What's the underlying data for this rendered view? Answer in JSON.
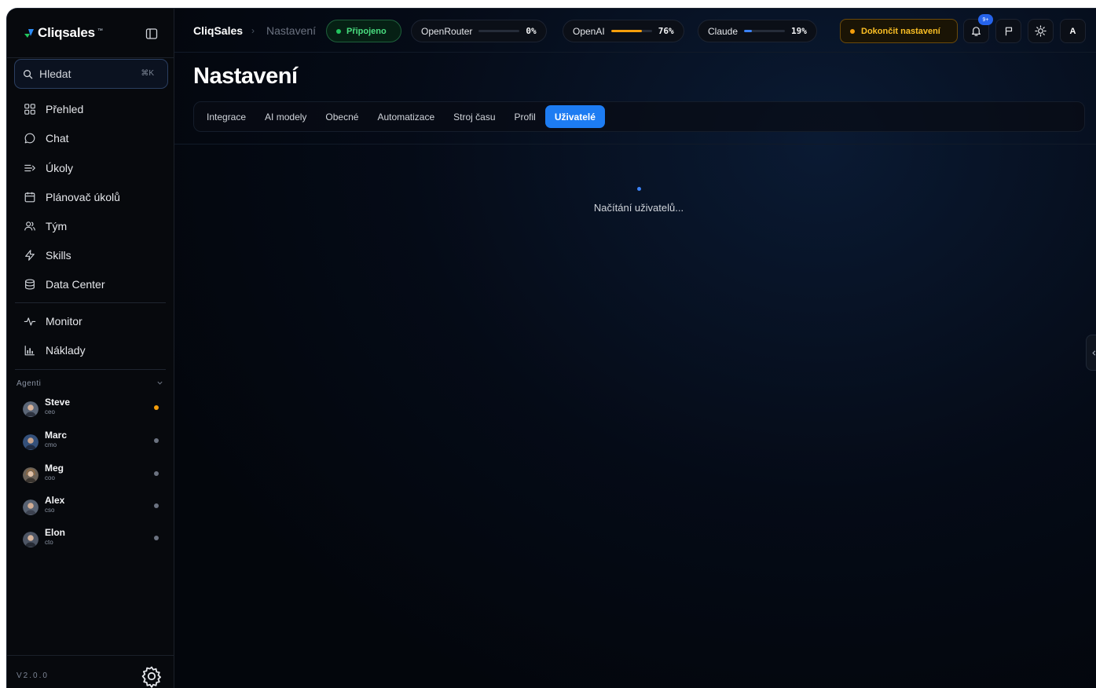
{
  "brand": {
    "name": "Cliqsales",
    "tm": "™"
  },
  "search": {
    "placeholder": "Hledat",
    "shortcut": "⌘K"
  },
  "nav": {
    "primary": [
      {
        "label": "Přehled",
        "icon": "grid-icon"
      },
      {
        "label": "Chat",
        "icon": "chat-icon"
      },
      {
        "label": "Úkoly",
        "icon": "tasks-icon"
      },
      {
        "label": "Plánovač úkolů",
        "icon": "calendar-icon"
      },
      {
        "label": "Tým",
        "icon": "team-icon"
      },
      {
        "label": "Skills",
        "icon": "lightning-icon"
      },
      {
        "label": "Data Center",
        "icon": "database-icon"
      }
    ],
    "secondary": [
      {
        "label": "Monitor",
        "icon": "activity-icon"
      },
      {
        "label": "Náklady",
        "icon": "bar-chart-icon"
      }
    ]
  },
  "agents": {
    "label": "Agenti",
    "items": [
      {
        "name": "Steve",
        "role": "ceo",
        "status_color": "#f59e0b"
      },
      {
        "name": "Marc",
        "role": "cmo",
        "status_color": "#6b7280"
      },
      {
        "name": "Meg",
        "role": "coo",
        "status_color": "#6b7280"
      },
      {
        "name": "Alex",
        "role": "cso",
        "status_color": "#6b7280"
      },
      {
        "name": "Elon",
        "role": "cto",
        "status_color": "#6b7280"
      }
    ]
  },
  "footer": {
    "version": "V2.0.0"
  },
  "header": {
    "breadcrumb_root": "CliqSales",
    "breadcrumb_separator": "›",
    "breadcrumb_current": "Nastavení",
    "connection_status": "Připojeno",
    "providers": [
      {
        "name": "OpenRouter",
        "percent": "0%",
        "value": 0,
        "color": "#3b82f6"
      },
      {
        "name": "OpenAI",
        "percent": "76%",
        "value": 0.76,
        "color": "#f59e0b"
      },
      {
        "name": "Claude",
        "percent": "19%",
        "value": 0.19,
        "color": "#3b82f6"
      }
    ],
    "finish_setup_label": "Dokončit nastavení",
    "notifications_badge": "9+",
    "user_initial": "A"
  },
  "page": {
    "title": "Nastavení",
    "tabs": [
      "Integrace",
      "AI modely",
      "Obecné",
      "Automatizace",
      "Stroj času",
      "Profil",
      "Uživatelé"
    ],
    "active_tab": "Uživatelé",
    "loading_text": "Načítání uživatelů..."
  },
  "colors": {
    "accent": "#1d7cf2",
    "success": "#22c55e",
    "warning": "#f59e0b",
    "background": "#03060c"
  }
}
